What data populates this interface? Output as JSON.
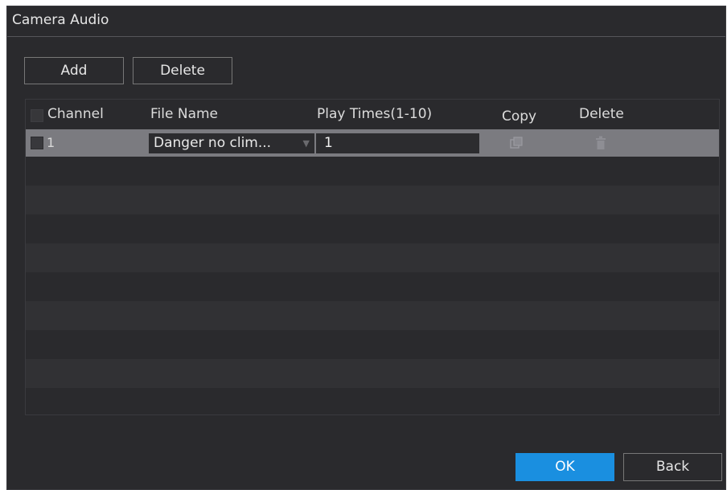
{
  "dialog": {
    "title": "Camera Audio"
  },
  "toolbar": {
    "add_label": "Add",
    "delete_label": "Delete"
  },
  "table": {
    "columns": [
      "Channel",
      "File Name",
      "Play Times(1-10)",
      "Copy",
      "Delete"
    ],
    "rows": [
      {
        "checked": false,
        "channel": "1",
        "file_name": "Danger no clim...",
        "play_times": "1",
        "copy_icon": "copy-icon",
        "delete_icon": "trash-icon"
      }
    ],
    "empty_rows": 9
  },
  "footer": {
    "ok_label": "OK",
    "back_label": "Back"
  },
  "colors": {
    "panel_bg": "#2a2a2d",
    "selected_row": "#7b7b80",
    "accent": "#1a8fe0",
    "text": "#e6e6e6"
  }
}
